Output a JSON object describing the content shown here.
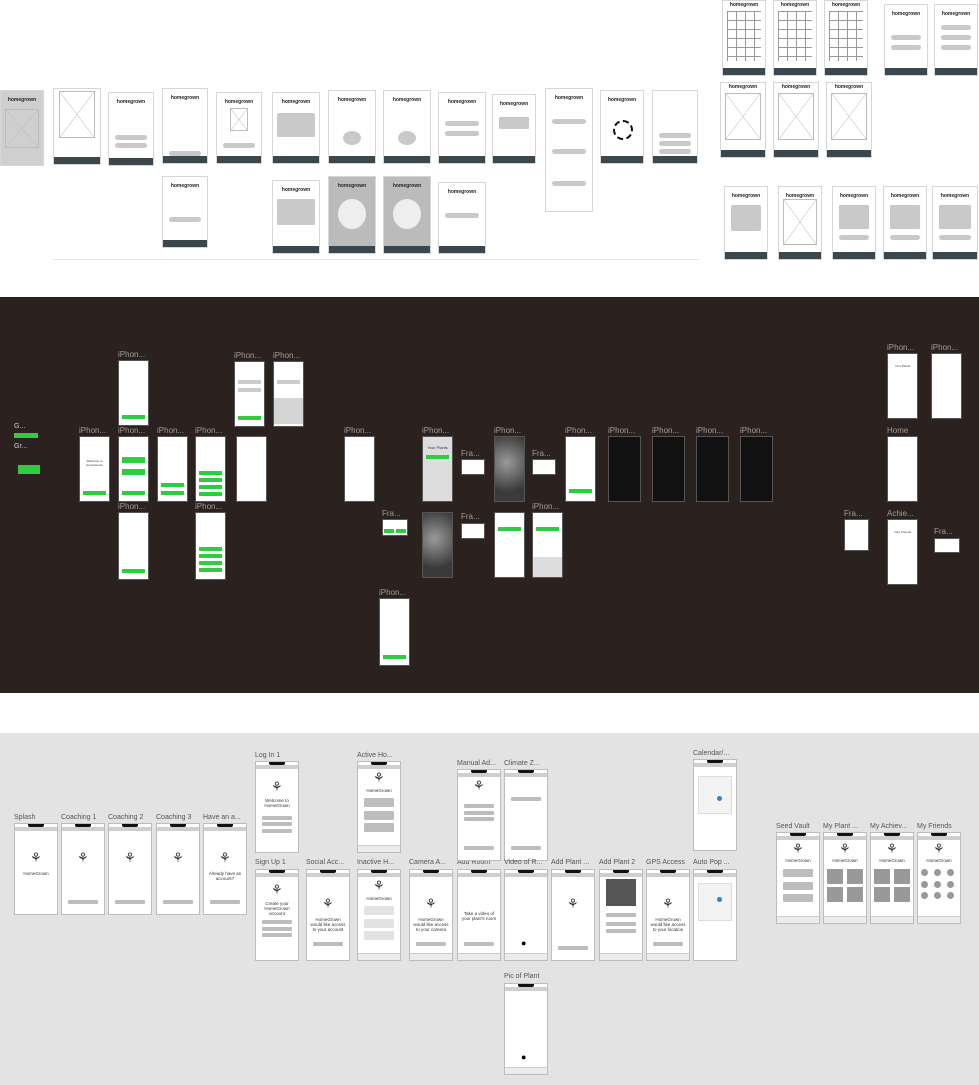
{
  "top": {
    "brand": "homegrown"
  },
  "middle": {
    "labels": {
      "iphone": "iPhon...",
      "frame": "Fra...",
      "home": "Home",
      "achie": "Achie..."
    },
    "components": {
      "c1": "G...",
      "c2": "Gr..."
    },
    "screen_text": {
      "welcome": "Welcome to HomeGrown",
      "your_plants": "Your Plants",
      "your_friends": "Your Friends"
    }
  },
  "bottom": {
    "app_name": "HomeGrown",
    "labels": {
      "splash": "Splash",
      "coaching1": "Coaching 1",
      "coaching2": "Coaching 2",
      "coaching3": "Coaching 3",
      "have_an": "Have an a...",
      "log_in": "Log In 1",
      "sign_up": "Sign Up 1",
      "social": "Social Acc...",
      "active": "Active Ho...",
      "inactive": "Inactive H...",
      "camera": "Camera A...",
      "add_room": "Add Room",
      "manual": "Manual Ad...",
      "climate": "Climate Z...",
      "video": "Video of R...",
      "pic": "Pic of Plant",
      "add_plant": "Add Plant ...",
      "add_plant2": "Add Plant 2",
      "gps": "GPS Access",
      "calendar": "Calendar/...",
      "auto_pop": "Auto Pop ...",
      "seed": "Seed Vault",
      "my_plant": "My Plant ...",
      "my_achiev": "My Achiev...",
      "my_friends": "My Friends"
    },
    "screen_text": {
      "welcome": "Welcome to HomeGrown",
      "have_account": "Already have an account?",
      "create": "Create your HomeGrown account",
      "social_access": "HomeGrown would like access to your account",
      "camera_access": "HomeGrown would like access to your camera",
      "take_video": "Take a video of your plant's room",
      "gps_access": "HomeGrown would like access to your location"
    }
  }
}
